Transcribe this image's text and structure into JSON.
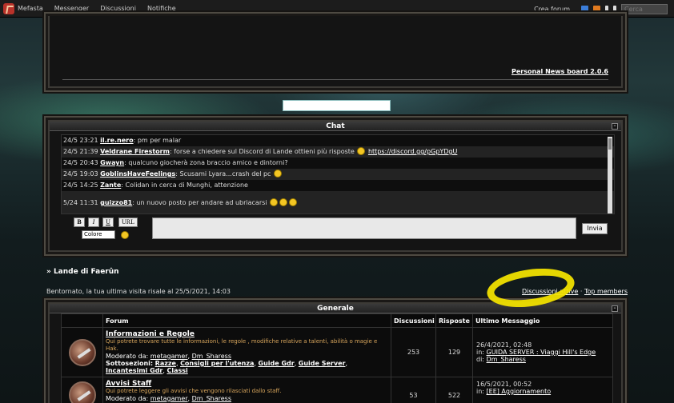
{
  "nav": {
    "site_name": "Mefasta",
    "links": [
      "Messenger",
      "Discussioni",
      "Notifiche"
    ],
    "crea_forum": "Crea forum",
    "search_placeholder": "Cerca"
  },
  "news": {
    "label": "Personal News board 2.0.6"
  },
  "chat": {
    "title": "Chat",
    "messages": [
      {
        "time": "24/5 23:21",
        "user": "il.re.nero",
        "text": ": pm per malar"
      },
      {
        "time": "24/5 21:39",
        "user": "Veldrane Firestorm",
        "text": ": forse a chiedere sul Discord di Lande ottieni più risposte",
        "link": "https://discord.gg/pGpYDgU"
      },
      {
        "time": "24/5 20:43",
        "user": "Gwayn",
        "text": ": qualcuno giocherà zona braccio amico e dintorni?"
      },
      {
        "time": "24/5 19:03",
        "user": "GoblinsHaveFeelings",
        "text": ": Scusami Lyara...crash del pc"
      },
      {
        "time": "24/5 14:25",
        "user": "Zante",
        "text": ": Colidan in cerca di Munghi, attenzione"
      },
      {
        "time": "5/24 11:31",
        "user": "guizzo81",
        "text": ": un nuovo posto per andare ad ubriacarsi"
      }
    ],
    "buttons": {
      "bold": "B",
      "italic": "I",
      "underline": "U",
      "url": "URL",
      "color": "Colore",
      "send": "Invia"
    }
  },
  "forum": {
    "breadcrumb": "» Lande di Faerûn",
    "welcome": "Bentornato, la tua ultima visita risale al 25/5/2021, 14:03",
    "active_link": "Discussioni attive",
    "separator": " · ",
    "members_link": "Top members",
    "category": "Generale",
    "columns": [
      "Forum",
      "Discussioni",
      "Risposte",
      "Ultimo Messaggio"
    ],
    "rows": [
      {
        "title": "Informazioni e Regole",
        "desc": "Qui potrete trovare tutte le informazioni, le regole , modifiche relative a talenti, abilità o magie e Hak.",
        "mod_label": "Moderato da:",
        "mods": [
          "metagamer",
          "Dm_Sharess"
        ],
        "sub_label": "Sottosezioni:",
        "subs": [
          "Razze",
          "Consigli per l'utenza",
          "Guide Gdr",
          "Guide Server",
          "Incantesimi Gdr",
          "Classi"
        ],
        "topics": "253",
        "replies": "129",
        "last_date": "26/4/2021, 02:48",
        "last_in": "GUIDA SERVER : Viaggi Hill's Edge",
        "last_by": "Dm_Sharess"
      },
      {
        "title": "Avvisi Staff",
        "desc": "Qui potrete leggere gli avvisi che vengono rilasciati dallo staff.",
        "mod_label": "Moderato da:",
        "mods": [
          "metagamer",
          "Dm_Sharess"
        ],
        "topics": "53",
        "replies": "522",
        "last_date": "16/5/2021, 00:52",
        "last_in": "[EE] Aggiornamento"
      }
    ]
  }
}
